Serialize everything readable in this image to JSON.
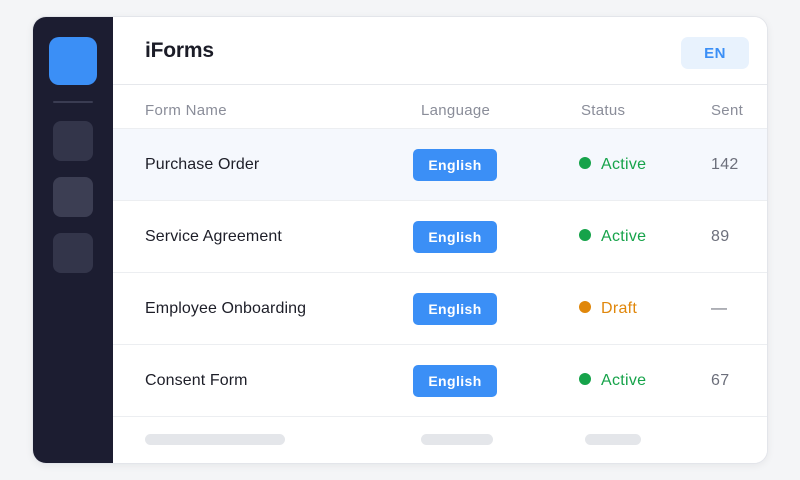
{
  "app": {
    "title": "iForms",
    "language_badge": "EN"
  },
  "colors": {
    "accent": "#3b8ff6",
    "sidebar": "#1c1d31",
    "active": "#16a34a",
    "draft": "#e0870b"
  },
  "table": {
    "columns": [
      "Form Name",
      "Language",
      "Status",
      "Sent"
    ],
    "rows": [
      {
        "name": "Purchase Order",
        "language": "English",
        "status": "Active",
        "sent": "142",
        "selected": true
      },
      {
        "name": "Service Agreement",
        "language": "English",
        "status": "Active",
        "sent": "89",
        "selected": false
      },
      {
        "name": "Employee Onboarding",
        "language": "English",
        "status": "Draft",
        "sent": "—",
        "selected": false
      },
      {
        "name": "Consent Form",
        "language": "English",
        "status": "Active",
        "sent": "67",
        "selected": false
      }
    ]
  }
}
